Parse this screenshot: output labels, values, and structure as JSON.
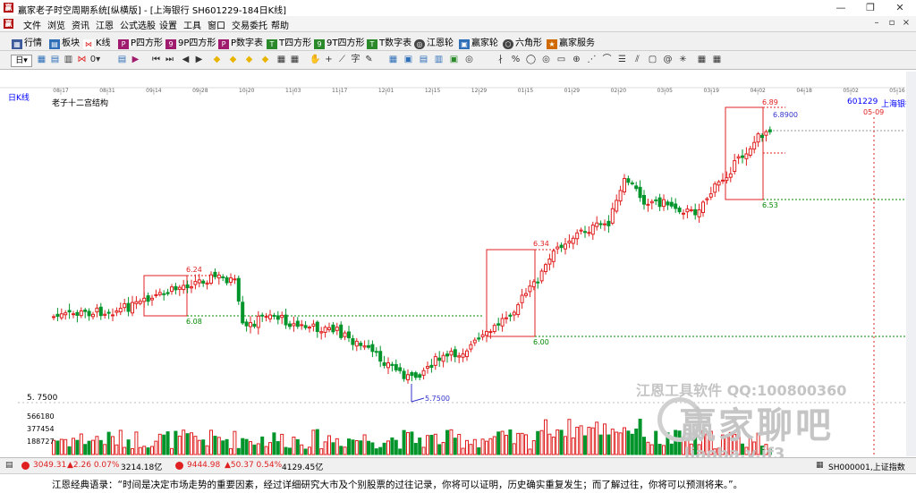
{
  "window": {
    "title": "赢家老子时空周期系统[纵横版] - [上海银行  SH601229-184日K线]",
    "min": "—",
    "max": "❐",
    "close": "✕"
  },
  "menu": {
    "items": [
      "文件",
      "浏览",
      "资讯",
      "江恩",
      "公式选股",
      "设置",
      "工具",
      "窗口",
      "交易委托",
      "帮助"
    ]
  },
  "toolbar1": {
    "items": [
      "行情",
      "板块",
      "K线",
      "P四方形",
      "9P四方形",
      "P数字表",
      "T四方形",
      "9T四方形",
      "T数字表",
      "江恩轮",
      "赢家轮",
      "六角形",
      "赢家服务"
    ]
  },
  "chart_header": {
    "period": "日K线",
    "indicator": "老子十二宫结构",
    "code": "601229",
    "name": "上海银行"
  },
  "dates": [
    "08-17",
    "08-31",
    "09-14",
    "09-28",
    "10-20",
    "11-03",
    "11-17",
    "12-01",
    "12-15",
    "12-29",
    "01-15",
    "01-29",
    "02-20",
    "03-05",
    "03-19",
    "04-02",
    "04-18",
    "05-02",
    "05-16"
  ],
  "annotations": {
    "box1_top": "6.24",
    "box1_bottom": "6.08",
    "box2_top": "6.34",
    "box2_bottom": "6.00",
    "box3_top": "6.89",
    "box3_bottom": "6.53",
    "current": "6.8900",
    "future_date": "05-09",
    "low": "5.7500"
  },
  "axis": {
    "price_low": "5. 7500",
    "vol_top": "566180",
    "vol_mid": "377454",
    "vol_low": "188727"
  },
  "watermark": {
    "line1": "江恩工具软件   QQ:100800360",
    "logo": "赢家聊吧",
    "url": "liaoba.v.jf3"
  },
  "status": {
    "sh_index": "3049.31",
    "sh_change": "▲2.26 0.07%",
    "sh_amount": "3214.18亿",
    "sz_index": "9444.98",
    "sz_change": "▲50.37 0.54%",
    "sz_amount": "4129.45亿",
    "ref_label": "SH000001,上证指数"
  },
  "quote": "江恩经典语录：“时间是决定市场走势的重要因素，经过详细研究大市及个别股票的过往记录，你将可以证明，历史确实重复发生；而了解过往，你将可以预测将来。”。",
  "colors": {
    "up": "#e02020",
    "down": "#00952a",
    "box": "#e02020"
  }
}
